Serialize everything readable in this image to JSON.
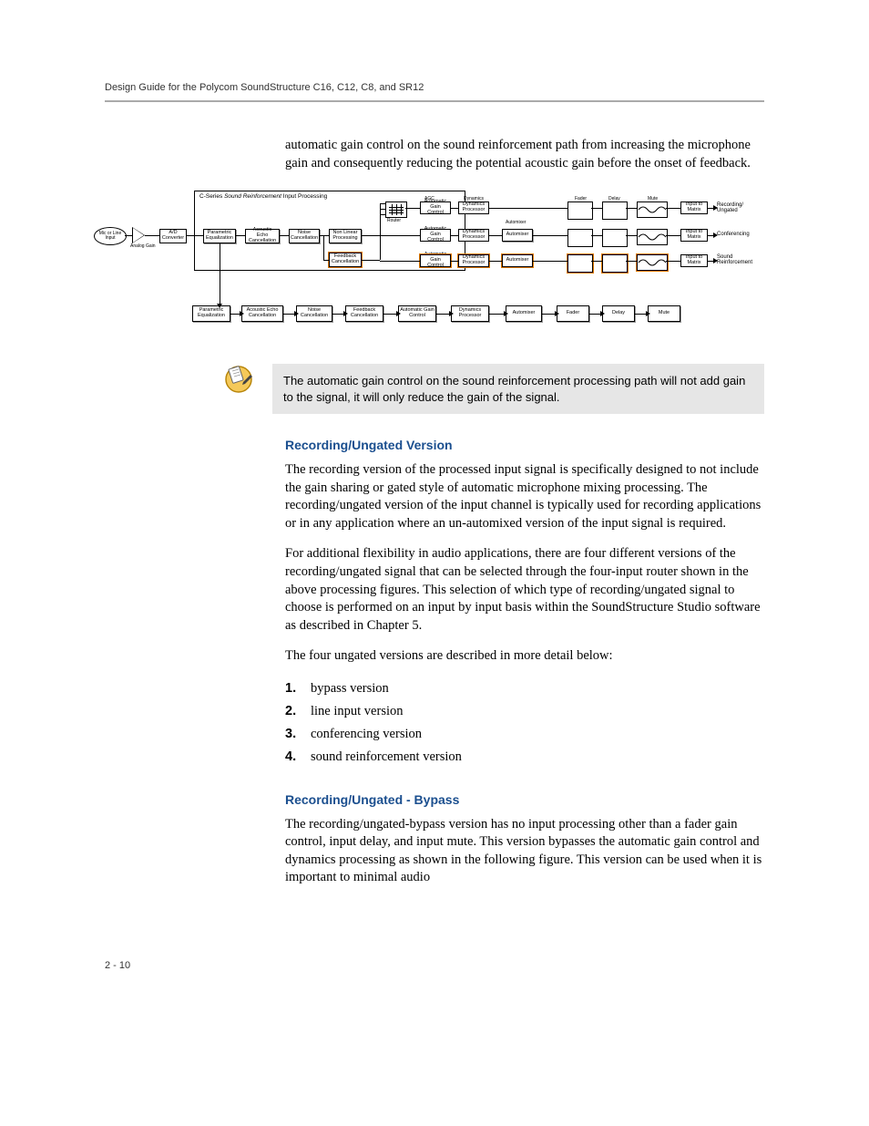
{
  "header": "Design Guide for the Polycom SoundStructure C16, C12, C8, and SR12",
  "para1": "automatic gain control on the sound reinforcement path from increasing the microphone gain and consequently reducing the potential acoustic gain before the onset of feedback.",
  "note": "The automatic gain control on the sound reinforcement processing path will not add gain to the signal, it will only reduce the gain of the signal.",
  "sec1_title": "Recording/Ungated Version",
  "sec1_p1": "The recording version of the processed input signal is specifically designed to not include the gain sharing or gated style of automatic microphone mixing processing. The recording/ungated version of the input channel is typically used for recording applications or in any application where an un-automixed version of the input signal is required.",
  "sec1_p2": "For additional flexibility in audio applications, there are four different versions of the recording/ungated signal that can be selected through the four-input router shown in the above processing figures. This selection of which type of recording/ungated signal to choose is performed on an input by input basis within the SoundStructure Studio software as described in Chapter 5.",
  "sec1_p3": "The four ungated versions are described in more detail below:",
  "list": [
    "bypass version",
    "line input version",
    "conferencing version",
    "sound reinforcement version"
  ],
  "sec2_title": "Recording/Ungated - Bypass",
  "sec2_p1": "The recording/ungated-bypass version has no input processing other than a fader gain control, input delay, and input mute. This version bypasses the automatic gain control and dynamics processing as shown in the following figure. This version can be used when it is important to minimal audio",
  "footer": "2 - 10",
  "diagram": {
    "frame_title_a": "C-Series ",
    "frame_title_b": "Sound Reinforcement",
    "frame_title_c": " Input Processing",
    "input_ellipse": "Mic or Line Input",
    "analog_gain": "Analog Gain",
    "ad": "A/D Converter",
    "peq": "Parametric Equalization",
    "aec": "Acoustic Echo Cancellation",
    "nc": "Noise Cancellation",
    "nlp": "Non Linear Processing",
    "fbc": "Feedback Cancellation",
    "router": "Router",
    "agc": "AGC",
    "agc_full": "Automatic Gain Control",
    "dyn": "Dynamics",
    "dyn_full": "Dynamics Processor",
    "automixer": "Automixer",
    "fader": "Fader",
    "delay": "Delay",
    "mute": "Mute",
    "imatrix": "Input to Matrix",
    "out1": "Recording/ Ungated",
    "out2": "Conferencing",
    "out3": "Sound Reinforcement",
    "bottom": {
      "b1": "Parametric Equalization",
      "b2": "Acoustic Echo Cancellation",
      "b3": "Noise Cancellation",
      "b4": "Feedback Cancellation",
      "b5": "Automatic Gain Control",
      "b6": "Dynamics Processor",
      "b7": "Automixer",
      "b8": "Fader",
      "b9": "Delay",
      "b10": "Mute"
    }
  }
}
